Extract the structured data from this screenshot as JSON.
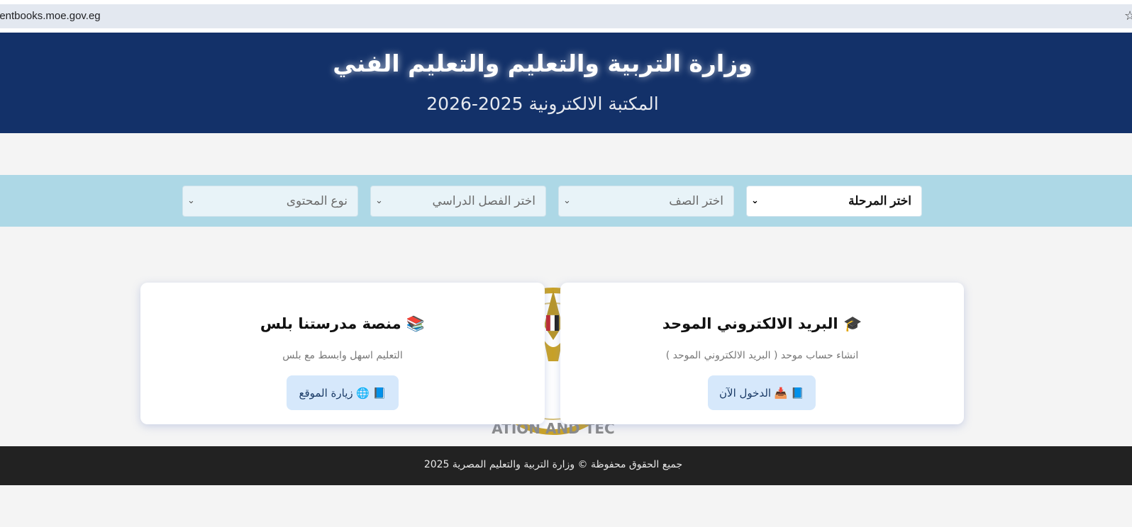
{
  "browser": {
    "url": "lentbooks.moe.gov.eg",
    "bookmark_icon": "star-icon"
  },
  "header": {
    "title": "وزارة التربية والتعليم والتعليم الفني",
    "subtitle": "المكتبة الالكترونية 2025-2026"
  },
  "filters": [
    {
      "label": "اختر المرحلة",
      "active": true
    },
    {
      "label": "اختر الصف",
      "active": false
    },
    {
      "label": "اختر الفصل الدراسي",
      "active": false
    },
    {
      "label": "نوع المحتوى",
      "active": false
    }
  ],
  "logo": {
    "text": "ATION AND TEC"
  },
  "cards": [
    {
      "icon": "🎓",
      "title": "البريد الالكتروني الموحد",
      "description": "انشاء حساب موحد ( البريد الالكتروني الموحد )",
      "button_label": "📘 📥 الدخول الآن"
    },
    {
      "icon": "📚",
      "title": "منصة مدرستنا بلس",
      "description": "التعليم اسهل وابسط مع بلس",
      "button_label": "📘 🌐 زيارة الموقع"
    }
  ],
  "footer": {
    "text": "جميع الحقوق محفوظة © وزارة التربية والتعليم المصرية 2025"
  },
  "colors": {
    "header_bg": "#133169",
    "filter_bar_bg": "#add8e6",
    "footer_bg": "#222222",
    "button_bg": "#d6e8fb",
    "logo_gold": "#c9a227"
  }
}
